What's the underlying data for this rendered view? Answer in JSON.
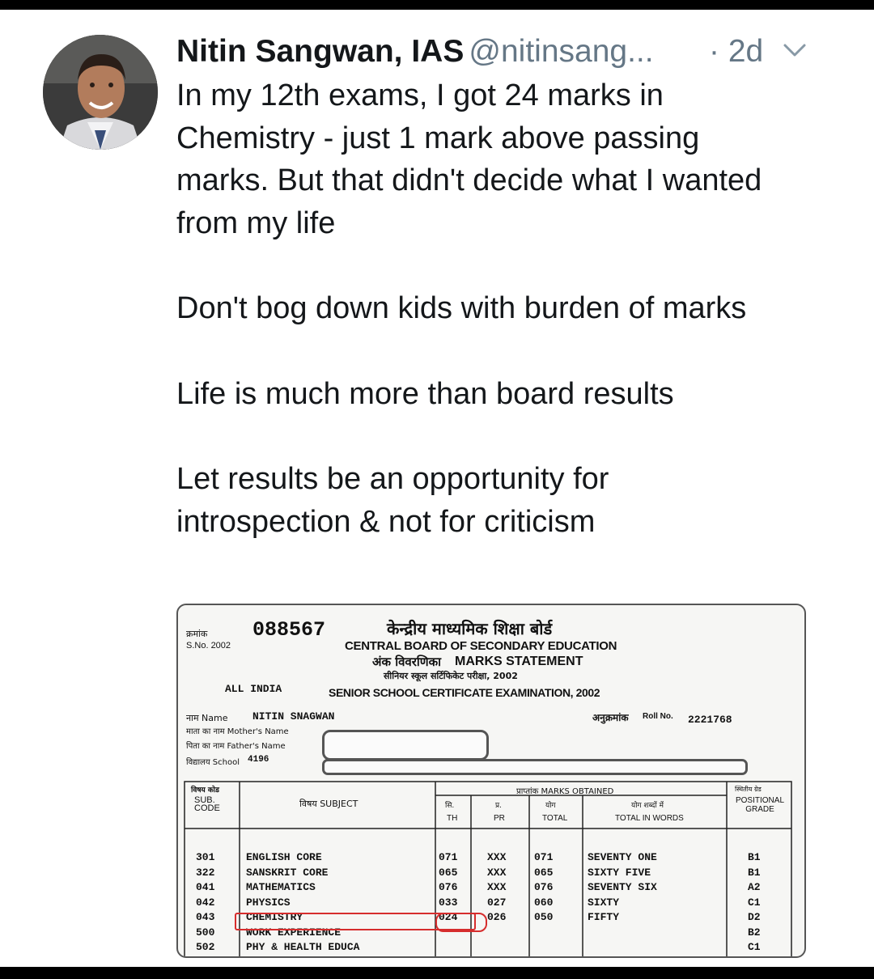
{
  "tweet": {
    "author_name": "Nitin Sangwan, IAS",
    "handle": "@nitinsang...",
    "time": "· 2d",
    "avatar_icon": "profile-photo",
    "menu_icon": "chevron-down-icon",
    "paragraphs": [
      "In my 12th exams, I got 24 marks in Chemistry - just 1 mark above passing marks. But that didn't decide what I wanted from my life",
      "Don't bog down kids with burden of marks",
      "Life is much more than board results",
      "Let results be an opportunity for introspection & not for criticism"
    ]
  },
  "document": {
    "sno_label_hi": "क्रमांक",
    "sno_label_en": "S.No. 2002",
    "serial": "088567",
    "board_hi": "केन्द्रीय माध्यमिक शिक्षा बोर्ड",
    "board_en": "CENTRAL BOARD OF SECONDARY EDUCATION",
    "statement_hi": "अंक विवरणिका",
    "statement_en": "MARKS STATEMENT",
    "exam_hi": "सीनियर स्कूल सर्टिफिकेट परीक्षा, 2002",
    "all_india": "ALL INDIA",
    "exam_en": "SENIOR SCHOOL CERTIFICATE EXAMINATION, 2002",
    "name_label": "नाम Name",
    "name_value": "NITIN SNAGWAN",
    "mother_label": "माता का नाम Mother's Name",
    "father_label": "पिता का नाम Father's Name",
    "school_label": "विद्यालय School",
    "school_value": "4196",
    "roll_label_hi": "अनुक्रमांक",
    "roll_label_en": "Roll No.",
    "roll_value": "2221768",
    "headers": {
      "code_hi": "विषय कोड",
      "code_en": "SUB. CODE",
      "subject": "विषय SUBJECT",
      "marks_obtained": "प्राप्तांक MARKS OBTAINED",
      "th_hi": "सि.",
      "th": "TH",
      "pr_hi": "प्र.",
      "pr": "PR",
      "total_hi": "योग",
      "total": "TOTAL",
      "words_hi": "योग शब्दों में",
      "words": "TOTAL IN WORDS",
      "grade_hi": "स्थितीय ग्रेड",
      "grade": "POSITIONAL GRADE"
    },
    "rows": [
      {
        "code": "301",
        "subject": "ENGLISH CORE",
        "th": "071",
        "pr": "XXX",
        "total": "071",
        "words": "SEVENTY ONE",
        "grade": "B1"
      },
      {
        "code": "322",
        "subject": "SANSKRIT CORE",
        "th": "065",
        "pr": "XXX",
        "total": "065",
        "words": "SIXTY FIVE",
        "grade": "B1"
      },
      {
        "code": "041",
        "subject": "MATHEMATICS",
        "th": "076",
        "pr": "XXX",
        "total": "076",
        "words": "SEVENTY SIX",
        "grade": "A2"
      },
      {
        "code": "042",
        "subject": "PHYSICS",
        "th": "033",
        "pr": "027",
        "total": "060",
        "words": "SIXTY",
        "grade": "C1"
      },
      {
        "code": "043",
        "subject": "CHEMISTRY",
        "th": "024",
        "pr": "026",
        "total": "050",
        "words": "FIFTY",
        "grade": "D2"
      },
      {
        "code": "500",
        "subject": "WORK EXPERIENCE",
        "th": "",
        "pr": "",
        "total": "",
        "words": "",
        "grade": "B2"
      },
      {
        "code": "502",
        "subject": "PHY & HEALTH EDUCA",
        "th": "",
        "pr": "",
        "total": "",
        "words": "",
        "grade": "C1"
      }
    ]
  }
}
